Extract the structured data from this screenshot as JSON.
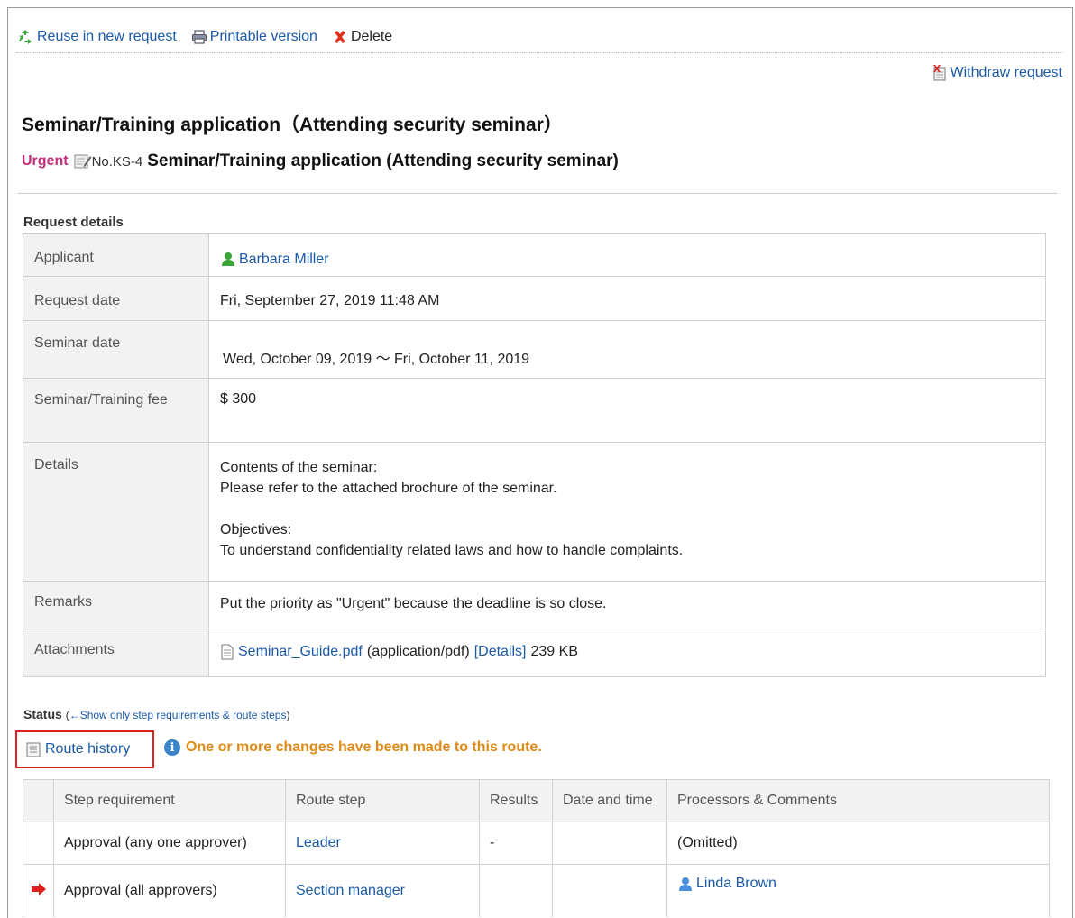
{
  "toolbar": {
    "reuse_label": "Reuse in new request",
    "print_label": "Printable version",
    "delete_label": "Delete"
  },
  "withdraw_label": "Withdraw request",
  "page_title": "Seminar/Training application（Attending security seminar）",
  "subtitle": {
    "priority": "Urgent",
    "number": "No.KS-4",
    "subject": "Seminar/Training application (Attending security seminar)"
  },
  "details": {
    "heading": "Request details",
    "applicant_label": "Applicant",
    "applicant_value": "Barbara Miller",
    "request_date_label": "Request date",
    "request_date_value": "Fri, September 27, 2019 11:48 AM",
    "seminar_date_label": "Seminar date",
    "seminar_date_value": "Wed, October 09, 2019 ～ Fri, October 11, 2019",
    "fee_label": "Seminar/Training fee",
    "fee_value": "$ 300",
    "details_label": "Details",
    "details_line1": "Contents of the seminar:",
    "details_line2": "Please refer to the attached brochure of the seminar.",
    "details_line3": "Objectives:",
    "details_line4": "To understand confidentiality related laws and how to handle complaints.",
    "remarks_label": "Remarks",
    "remarks_value": "Put the priority as \"Urgent\" because the deadline is so close.",
    "attachments_label": "Attachments",
    "attachment_file": "Seminar_Guide.pdf",
    "attachment_type": "(application/pdf)",
    "attachment_details_link": "[Details]",
    "attachment_size": "239 KB"
  },
  "status": {
    "heading": "Status",
    "open_paren": "(",
    "toggle_link": "←Show only step requirements & route steps",
    "close_paren": ")",
    "route_history": "Route history",
    "notice": "One or more changes have been made to this route."
  },
  "route_table": {
    "headers": [
      "",
      "Step requirement",
      "Route step",
      "Results",
      "Date and time",
      "Processors & Comments"
    ],
    "rows": [
      {
        "step_requirement": "Approval (any one approver)",
        "route_step": "Leader",
        "result": "-",
        "date": "",
        "processors": "(Omitted)"
      },
      {
        "step_requirement": "Approval (all approvers)",
        "route_step": "Section manager",
        "result": "",
        "date": "",
        "processors": "Linda Brown"
      }
    ]
  },
  "colors": {
    "link": "#1a5aa8",
    "urgent": "#c0307a",
    "notice": "#e08a16",
    "highlight_border": "#e0201c",
    "label_bg": "#f2f2f2"
  }
}
